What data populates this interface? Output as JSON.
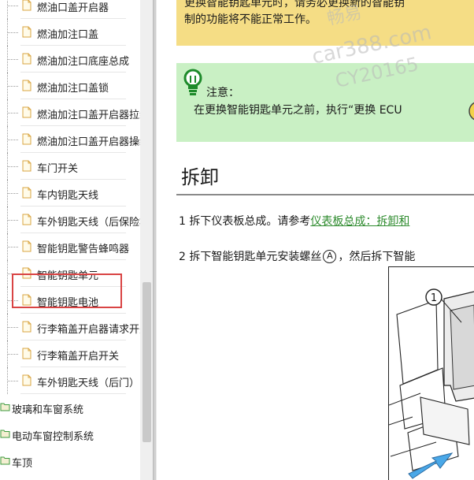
{
  "sidebar": {
    "items": [
      {
        "label": "燃油口盖开启器",
        "type": "doc"
      },
      {
        "label": "燃油加注口盖",
        "type": "doc"
      },
      {
        "label": "燃油加注口底座总成",
        "type": "doc"
      },
      {
        "label": "燃油加注口盖锁",
        "type": "doc"
      },
      {
        "label": "燃油加注口盖开启器拉线",
        "type": "doc"
      },
      {
        "label": "燃油加注口盖开启器操纵",
        "type": "doc"
      },
      {
        "label": "车门开关",
        "type": "doc"
      },
      {
        "label": "车内钥匙天线",
        "type": "doc"
      },
      {
        "label": "车外钥匙天线（后保险杠）",
        "type": "doc"
      },
      {
        "label": "智能钥匙警告蜂鸣器",
        "type": "doc"
      },
      {
        "label": "智能钥匙单元",
        "type": "doc",
        "highlighted": true
      },
      {
        "label": "智能钥匙电池",
        "type": "doc"
      },
      {
        "label": "行李箱盖开启器请求开关",
        "type": "doc"
      },
      {
        "label": "行李箱盖开启开关",
        "type": "doc"
      },
      {
        "label": "车外钥匙天线（后门）",
        "type": "doc"
      },
      {
        "label": "玻璃和车窗系统",
        "type": "folder"
      },
      {
        "label": "电动车窗控制系统",
        "type": "folder"
      },
      {
        "label": "车顶",
        "type": "folder"
      }
    ]
  },
  "main": {
    "warning": {
      "line1": "更换智能钥匙单元时，请务必更换新的智能钥",
      "line2": "制的功能将不能正常工作。"
    },
    "note": {
      "title": "注意：",
      "body": "在更换智能钥匙单元之前，执行“更换 ECU"
    },
    "section_title": "拆卸",
    "step1": {
      "prefix": "1 拆下仪表板总成。请参考",
      "link": "仪表板总成：拆卸和"
    },
    "step2": {
      "prefix": "2 拆下智能钥匙单元安装螺丝",
      "marker": "A",
      "suffix": "，然后拆下智能"
    },
    "figure": {
      "callout": "1"
    }
  },
  "watermark": {
    "line1": "畅易",
    "line2": "car388.com",
    "line3": "CY20165"
  },
  "colors": {
    "warning_bg": "#f5dd85",
    "note_bg": "#c9f0c4",
    "link": "#2e8b2e",
    "highlight": "#d94444"
  }
}
